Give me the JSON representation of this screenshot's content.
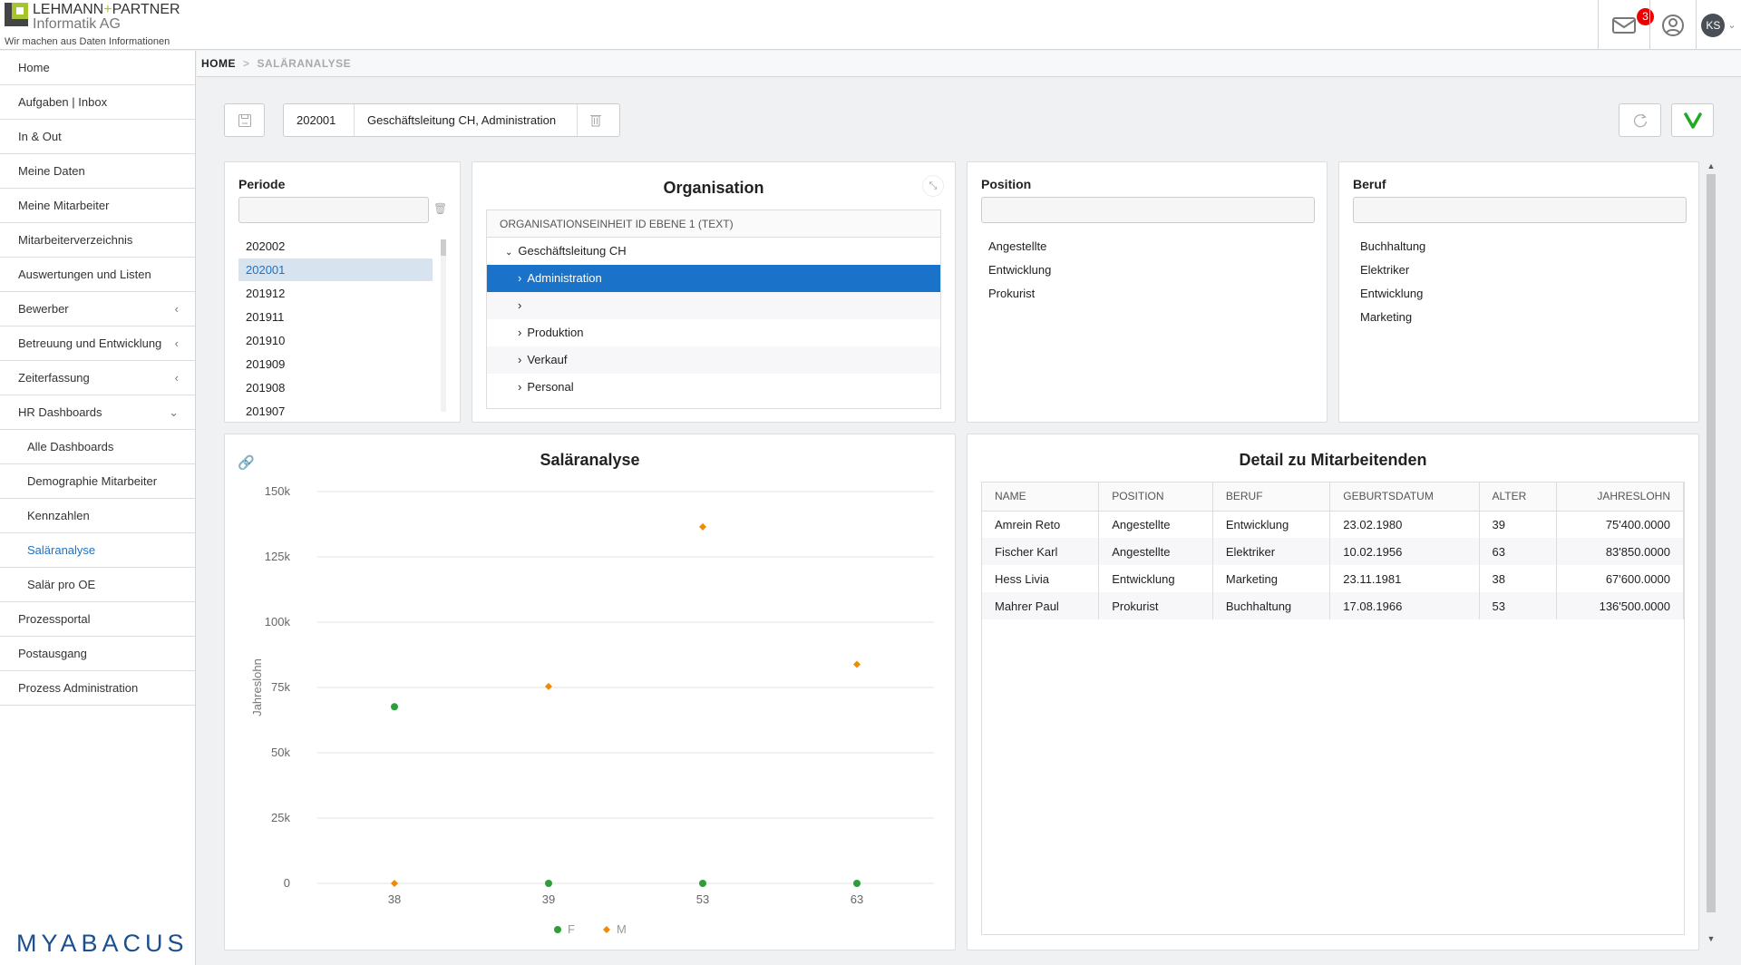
{
  "header": {
    "logo_line1a": "LEHMANN",
    "logo_plus": "+",
    "logo_line1b": "PARTNER",
    "logo_line2": "Informatik AG",
    "tagline": "Wir machen aus Daten Informationen",
    "mail_badge": "3",
    "user_initials": "KS"
  },
  "sidebar": {
    "items": [
      {
        "label": "Home"
      },
      {
        "label": "Aufgaben | Inbox"
      },
      {
        "label": "In & Out"
      },
      {
        "label": "Meine Daten"
      },
      {
        "label": "Meine Mitarbeiter"
      },
      {
        "label": "Mitarbeiterverzeichnis"
      },
      {
        "label": "Auswertungen und Listen"
      },
      {
        "label": "Bewerber",
        "chev": "‹"
      },
      {
        "label": "Betreuung und Entwicklung",
        "chev": "‹"
      },
      {
        "label": "Zeiterfassung",
        "chev": "‹"
      },
      {
        "label": "HR Dashboards",
        "chev": "⌄"
      },
      {
        "label": "Alle Dashboards",
        "sub": true
      },
      {
        "label": "Demographie Mitarbeiter",
        "sub": true
      },
      {
        "label": "Kennzahlen",
        "sub": true
      },
      {
        "label": "Saläranalyse",
        "sub": true,
        "active": true
      },
      {
        "label": "Salär pro OE",
        "sub": true
      },
      {
        "label": "Prozessportal"
      },
      {
        "label": "Postausgang"
      },
      {
        "label": "Prozess Administration"
      }
    ],
    "brand": "MYABACUS"
  },
  "breadcrumb": {
    "home": "HOME",
    "sep": ">",
    "current": "SALÄRANALYSE"
  },
  "toolbar": {
    "period": "202001",
    "org": "Geschäftsleitung CH, Administration"
  },
  "periode": {
    "label": "Periode",
    "items": [
      "202002",
      "202001",
      "201912",
      "201911",
      "201910",
      "201909",
      "201908",
      "201907"
    ],
    "selected": "202001"
  },
  "organisation": {
    "title": "Organisation",
    "column": "ORGANISATIONSEINHEIT ID EBENE 1 (TEXT)",
    "root": "Geschäftsleitung CH",
    "children": [
      "Administration",
      "",
      "Produktion",
      "Verkauf",
      "Personal"
    ],
    "selected": "Administration"
  },
  "position": {
    "label": "Position",
    "items": [
      "Angestellte",
      "Entwicklung",
      "Prokurist"
    ]
  },
  "beruf": {
    "label": "Beruf",
    "items": [
      "Buchhaltung",
      "Elektriker",
      "Entwicklung",
      "Marketing"
    ]
  },
  "chart_data": {
    "type": "scatter",
    "title": "Saläranalyse",
    "xlabel": "",
    "ylabel": "Jahreslohn",
    "categories": [
      "38",
      "39",
      "53",
      "63"
    ],
    "ylim": [
      0,
      150000
    ],
    "yticks": [
      "0",
      "25k",
      "50k",
      "75k",
      "100k",
      "125k",
      "150k"
    ],
    "grid": true,
    "legend_position": "bottom",
    "series": [
      {
        "name": "F",
        "color": "#2e9e3a",
        "marker": "circle",
        "values": [
          67600,
          0,
          0,
          0
        ]
      },
      {
        "name": "M",
        "color": "#f08a00",
        "marker": "diamond",
        "values": [
          0,
          75400,
          136500,
          83850
        ]
      }
    ]
  },
  "detail": {
    "title": "Detail zu Mitarbeitenden",
    "columns": [
      "NAME",
      "POSITION",
      "BERUF",
      "GEBURTSDATUM",
      "ALTER",
      "JAHRESLOHN"
    ],
    "rows": [
      [
        "Amrein Reto",
        "Angestellte",
        "Entwicklung",
        "23.02.1980",
        "39",
        "75'400.0000"
      ],
      [
        "Fischer Karl",
        "Angestellte",
        "Elektriker",
        "10.02.1956",
        "63",
        "83'850.0000"
      ],
      [
        "Hess Livia",
        "Entwicklung",
        "Marketing",
        "23.11.1981",
        "38",
        "67'600.0000"
      ],
      [
        "Mahrer Paul",
        "Prokurist",
        "Buchhaltung",
        "17.08.1966",
        "53",
        "136'500.0000"
      ]
    ]
  },
  "colors": {
    "accent": "#1a73c8",
    "confirm": "#22aa22",
    "badge": "#e00000"
  }
}
